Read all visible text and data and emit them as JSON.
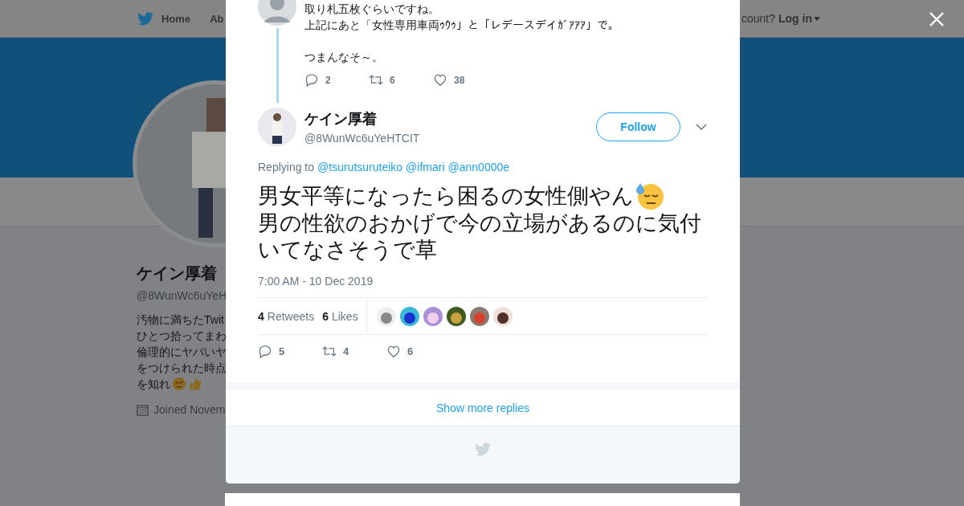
{
  "nav": {
    "items": [
      {
        "label": "Home",
        "selected": false
      },
      {
        "label": "Ab",
        "selected": false
      }
    ],
    "account_prompt": "count?",
    "login": "Log in"
  },
  "profile": {
    "name": "ケイン厚着",
    "handle": "@8WunWc6uYeH",
    "bio_lines": [
      "汚物に満ちたTwit",
      "ひとつ拾ってまわ",
      "倫理的にヤバいヤ",
      "をつけられた時点",
      "を知れ"
    ],
    "joined": "Joined Novem"
  },
  "parent_tweet": {
    "paragraphs": [
      [
        "取り札五枚ぐらいですね。",
        "上記にあと「女性専用車両ｩｳｩ」と「レデースデイｶﾞｱｱｱ」で。"
      ],
      [
        "つまんなそ～。"
      ]
    ],
    "actions": {
      "replies": "2",
      "retweets": "6",
      "likes": "38"
    }
  },
  "tweet": {
    "name": "ケイン厚着",
    "handle": "@8WunWc6uYeHTCIT",
    "follow": "Follow",
    "replying_label": "Replying to",
    "mentions": [
      "@tsurutsuruteiko",
      "@ifmari",
      "@ann0000e"
    ],
    "lines": [
      "男女平等になったら困るの女性側やん",
      "男の性欲のおかげで今の立場があるのに気付いてなさそうで草"
    ],
    "timestamp": "7:00 AM - 10 Dec 2019",
    "stats": [
      {
        "count": "4",
        "label": "Retweets"
      },
      {
        "count": "6",
        "label": "Likes"
      }
    ],
    "liker_avatars": [
      {
        "kind": "picture"
      },
      {
        "kind": "picture"
      },
      {
        "kind": "picture"
      },
      {
        "kind": "picture"
      },
      {
        "kind": "picture"
      },
      {
        "kind": "picture"
      }
    ],
    "actions": {
      "replies": "5",
      "retweets": "4",
      "likes": "6"
    }
  },
  "show_more": "Show more replies"
}
